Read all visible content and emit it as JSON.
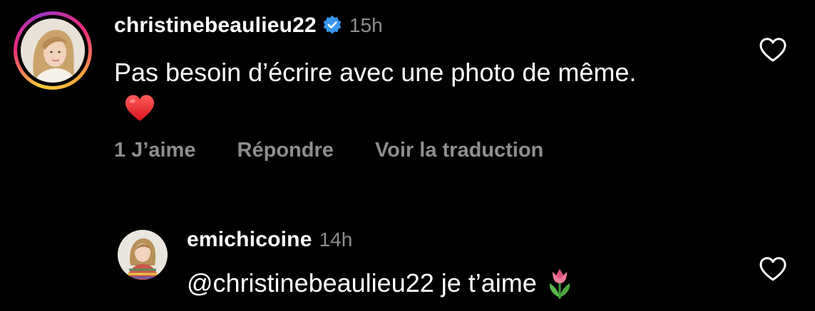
{
  "comment": {
    "username": "christinebeaulieu22",
    "verified": true,
    "time": "15h",
    "text": "Pas besoin d’écrire avec une photo de même.",
    "emoji": "red-heart-emoji",
    "actions": {
      "likes": "1 J’aime",
      "reply": "Répondre",
      "translate": "Voir la traduction"
    },
    "story_ring": true
  },
  "reply": {
    "username": "emichicoine",
    "time": "14h",
    "text": "@christinebeaulieu22 je t’aime",
    "emoji": "tulip-emoji"
  },
  "colors": {
    "background": "#000000",
    "primary_text": "#ffffff",
    "secondary_text": "#8e8e8e",
    "verified_badge": "#3897f0"
  }
}
